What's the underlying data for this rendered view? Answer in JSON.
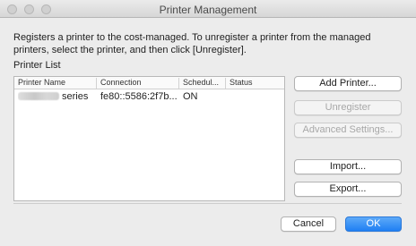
{
  "window": {
    "title": "Printer Management"
  },
  "description": "Registers a printer to the cost-managed. To unregister a printer from the managed printers, select the printer, and then click [Unregister].",
  "printer_list": {
    "label": "Printer List",
    "columns": [
      "Printer Name",
      "Connection",
      "Schedul...",
      "Status"
    ],
    "rows": [
      {
        "name_suffix": "series",
        "connection": "fe80::5586:2f7b...",
        "schedule": "ON",
        "status": ""
      }
    ]
  },
  "buttons": {
    "add_printer": "Add Printer...",
    "unregister": "Unregister",
    "advanced_settings": "Advanced Settings...",
    "import": "Import...",
    "export": "Export...",
    "cancel": "Cancel",
    "ok": "OK"
  },
  "colors": {
    "accent": "#1f7ff3",
    "window_bg": "#ececec"
  }
}
